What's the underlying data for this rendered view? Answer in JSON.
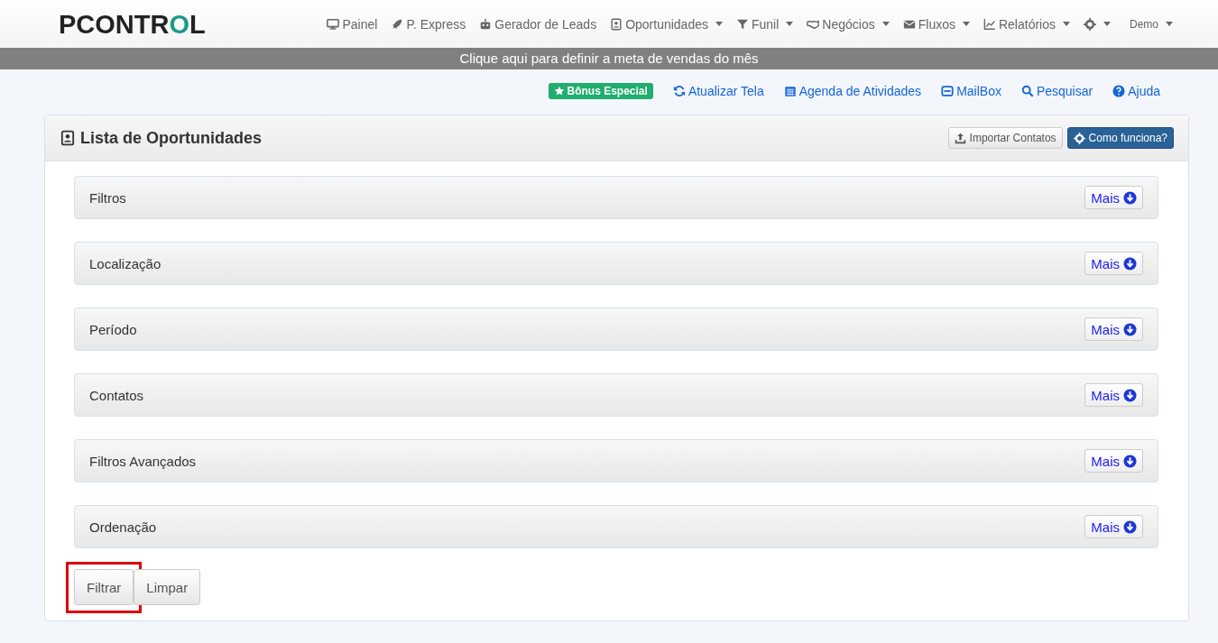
{
  "logo": {
    "text": "PCONTROL"
  },
  "nav": [
    {
      "label": "Painel",
      "dropdown": false
    },
    {
      "label": "P. Express",
      "dropdown": false
    },
    {
      "label": "Gerador de Leads",
      "dropdown": false
    },
    {
      "label": "Oportunidades",
      "dropdown": true
    },
    {
      "label": "Funil",
      "dropdown": true
    },
    {
      "label": "Negócios",
      "dropdown": true
    },
    {
      "label": "Fluxos",
      "dropdown": true
    },
    {
      "label": "Relatórios",
      "dropdown": true
    },
    {
      "dropdown": true
    },
    {
      "label": "Demo",
      "dropdown": true
    }
  ],
  "banner": "Clique aqui para definir a meta de vendas do mês",
  "badge": "Bônus Especial",
  "links": [
    "Atualizar Tela",
    "Agenda de Atividades",
    "MailBox",
    "Pesquisar",
    "Ajuda"
  ],
  "panel": {
    "title": "Lista de Oportunidades",
    "header_buttons": [
      {
        "label": "Importar Contatos",
        "kind": "default"
      },
      {
        "label": "Como funciona?",
        "kind": "primary"
      }
    ],
    "sections": [
      {
        "title": "Filtros",
        "button": "Mais"
      },
      {
        "title": "Localização",
        "button": "Mais"
      },
      {
        "title": "Período",
        "button": "Mais"
      },
      {
        "title": "Contatos",
        "button": "Mais"
      },
      {
        "title": "Filtros Avançados",
        "button": "Mais"
      },
      {
        "title": "Ordenação",
        "button": "Mais"
      }
    ],
    "actions": [
      {
        "label": "Filtrar",
        "highlighted": true
      },
      {
        "label": "Limpar",
        "highlighted": false
      }
    ]
  }
}
